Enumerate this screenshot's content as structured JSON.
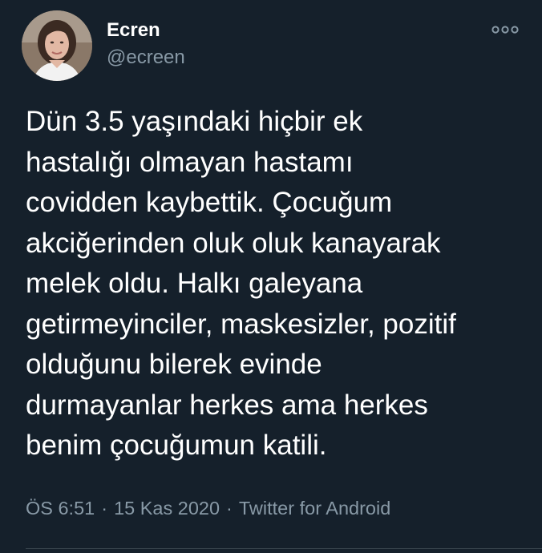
{
  "author": {
    "name": "Ecren",
    "handle": "@ecreen",
    "avatar_icon": "profile-photo"
  },
  "more_icon": "more-options-icon",
  "tweet": {
    "lines": [
      "Dün 3.5 yaşındaki hiçbir ek",
      "hastalığı olmayan hastamı",
      "covidden kaybettik. Çocuğum",
      "akciğerinden oluk oluk kanayarak",
      "melek oldu. Halkı galeyana",
      "getirmeyinciler, maskesizler, pozitif",
      "olduğunu bilerek evinde",
      "durmayanlar herkes ama herkes",
      "benim çocuğumun katili."
    ]
  },
  "meta": {
    "time": "ÖS 6:51",
    "separator": "·",
    "date": "15 Kas 2020",
    "source": "Twitter for Android"
  },
  "colors": {
    "background": "#15202b",
    "text": "#ffffff",
    "secondary": "#8899a6",
    "divider": "#38444d"
  }
}
